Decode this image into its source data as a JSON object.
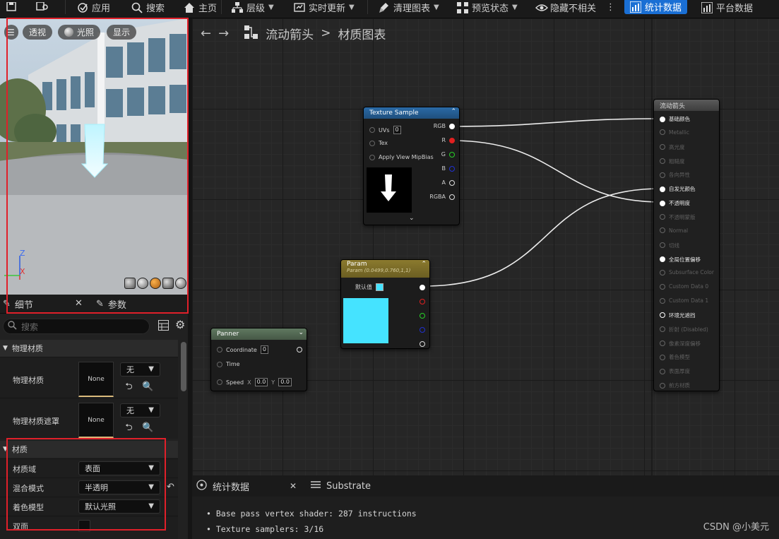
{
  "toolbar": {
    "apply": "应用",
    "search": "搜索",
    "home": "主页",
    "hierarchy": "层级",
    "live_update": "实时更新",
    "clean_graph": "清理图表",
    "preview_state": "预览状态",
    "hide_unrelated": "隐藏不相关",
    "stats": "统计数据",
    "platform_stats": "平台数据"
  },
  "viewport": {
    "perspective": "透视",
    "lit": "光照",
    "show": "显示",
    "axis_z": "Z",
    "axis_x": "X"
  },
  "panel_tabs": {
    "details": "细节",
    "params": "参数"
  },
  "details": {
    "search_placeholder": "搜索",
    "physics_category": "物理材质",
    "phys_material_label": "物理材质",
    "phys_material_value": "None",
    "phys_material_combo": "无",
    "phys_mask_label": "物理材质遮罩",
    "phys_mask_value": "None",
    "phys_mask_combo": "无",
    "material_category": "材质",
    "domain_label": "材质域",
    "domain_value": "表面",
    "blend_label": "混合模式",
    "blend_value": "半透明",
    "shading_label": "着色模型",
    "shading_value": "默认光照",
    "twosided_label": "双面"
  },
  "graph": {
    "breadcrumb_root": "流动箭头",
    "breadcrumb_sep": ">",
    "breadcrumb_leaf": "材质图表"
  },
  "nodes": {
    "texture": {
      "title": "Texture Sample",
      "uvs": "UVs",
      "uvs_val": "0",
      "tex": "Tex",
      "mip": "Apply View MipBias",
      "out_rgb": "RGB",
      "out_r": "R",
      "out_g": "G",
      "out_b": "B",
      "out_a": "A",
      "out_rgba": "RGBA"
    },
    "param": {
      "title": "Param",
      "subtitle": "Param (0.0499,0.760,1,1)",
      "default_label": "默认值"
    },
    "panner": {
      "title": "Panner",
      "coord": "Coordinate",
      "coord_val": "0",
      "time": "Time",
      "speed": "Speed",
      "sx": "X",
      "sx_val": "0.0",
      "sy": "Y",
      "sy_val": "0.0"
    },
    "result": {
      "title": "流动箭头",
      "pins": [
        "基础颜色",
        "Metallic",
        "高光度",
        "粗糙度",
        "各向异性",
        "自发光颜色",
        "不透明度",
        "不透明蒙版",
        "Normal",
        "切线",
        "全局位置偏移",
        "Subsurface Color",
        "Custom Data 0",
        "Custom Data 1",
        "环境光遮挡",
        "折射 (Disabled)",
        "像素深度偏移",
        "着色模型",
        "表面厚度",
        "前方材质"
      ],
      "active": [
        0,
        5,
        6,
        10,
        14
      ]
    }
  },
  "stats": {
    "tab_stats": "统计数据",
    "tab_substrate": "Substrate",
    "line1": "Base pass vertex shader: 287 instructions",
    "line2": "Texture samplers: 3/16"
  },
  "watermark": "CSDN @小美元",
  "colors": {
    "param_color": "#45e3ff",
    "accent": "#1a6fd4",
    "highlight": "#e0202a"
  }
}
